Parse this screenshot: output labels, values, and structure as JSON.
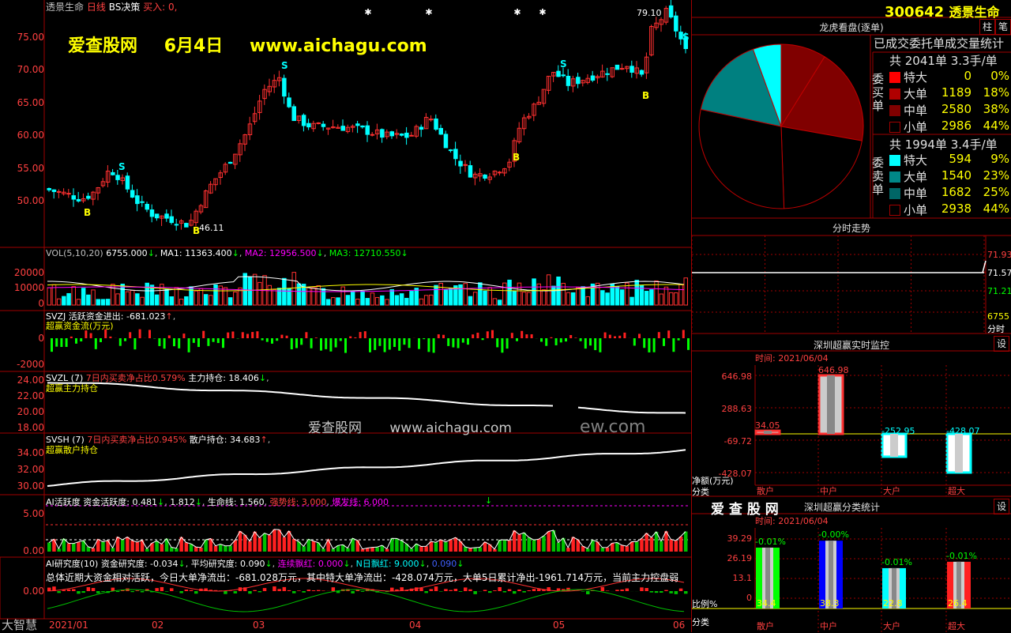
{
  "stock": {
    "code": "300642",
    "name": "透景生命"
  },
  "main": {
    "title": "透景生命",
    "period": "日线",
    "indicator": "BS决策",
    "buy_text": "买入: 0,",
    "y_ticks": [
      "75.00",
      "70.00",
      "65.00",
      "60.00",
      "55.00",
      "50.00"
    ],
    "high_label": "79.10",
    "low_label": "46.11",
    "buy_marker": "B",
    "sell_marker": "S",
    "watermark": {
      "site": "爱查股网",
      "date": "6月4日",
      "url": "www.aichagu.com"
    }
  },
  "vol": {
    "header": [
      "VOL(5,10,20)",
      "6755.000",
      "MA1: 11363.400",
      "MA2: 12956.500",
      "MA3: 12710.550"
    ],
    "y_ticks": [
      "20000",
      "10000",
      "0"
    ]
  },
  "svzj": {
    "header": [
      "SVZJ",
      "活跃资金进出: -681.023",
      "超赢资金流(万元)"
    ],
    "y_ticks": [
      "0",
      "-2000"
    ]
  },
  "svzl": {
    "header": [
      "SVZL (7)",
      "7日内买卖净占比0.579%",
      "主力持仓: 18.406",
      "超赢主力持仓"
    ],
    "y_ticks": [
      "24.00",
      "22.00",
      "20.00",
      "18.00"
    ]
  },
  "svsh": {
    "header": [
      "SVSH (7)",
      "7日内买卖净占比0.945%",
      "散户持仓: 34.683",
      "超赢散户持仓"
    ],
    "y_ticks": [
      "34.00",
      "32.00",
      "30.00"
    ]
  },
  "mid_watermark": {
    "site": "爱查股网",
    "url": "www.aichagu.com",
    "ghost": "ew.com"
  },
  "ai_active": {
    "header": [
      "AI活跃度",
      "资金活跃度: 0.481",
      "1.812",
      "生命线: 1.560",
      "强势线: 3.000",
      "爆发线: 6.000"
    ],
    "y_ticks": [
      "5.00",
      "0.00"
    ]
  },
  "ai_research": {
    "header": [
      "AI研究度(10)",
      "资金研究度: -0.034",
      "平均研究度: 0.090",
      "连续飘红: 0.000",
      "N日飘红: 9.000",
      "0.090"
    ],
    "summary": "总体近期大资金相对活跃，今日大单净流出：-681.028万元，其中特大单净流出：-428.074万元，大单5日累计净出-1961.714万元，当前主力控盘弱",
    "y_ticks": [
      "0.00"
    ]
  },
  "brand": "大智慧",
  "x_axis": [
    "2021/01",
    "02",
    "03",
    "04",
    "05",
    "06"
  ],
  "right_tabs": [
    "柱",
    "笔"
  ],
  "lhb": {
    "title": "龙虎看盘(逐单)",
    "subtitle": "已成交委托单成交量统计",
    "buy_label": "委买单",
    "sell_label": "委卖单",
    "buy_total": "共 2041单 3.3手/单",
    "sell_total": "共 1994单 3.4手/单",
    "buy_rows": [
      {
        "name": "特大",
        "count": "0",
        "pct": "0%",
        "color": "#ff0000"
      },
      {
        "name": "大单",
        "count": "1189",
        "pct": "18%",
        "color": "#b00000"
      },
      {
        "name": "中单",
        "count": "2580",
        "pct": "38%",
        "color": "#800000"
      },
      {
        "name": "小单",
        "count": "2986",
        "pct": "44%",
        "color": "#000000"
      }
    ],
    "sell_rows": [
      {
        "name": "特大",
        "count": "594",
        "pct": "9%",
        "color": "#00ffff"
      },
      {
        "name": "大单",
        "count": "1540",
        "pct": "23%",
        "color": "#008888"
      },
      {
        "name": "中单",
        "count": "1682",
        "pct": "25%",
        "color": "#006666"
      },
      {
        "name": "小单",
        "count": "2938",
        "pct": "44%",
        "color": "#000000"
      }
    ]
  },
  "intraday": {
    "title": "分时走势",
    "prices": [
      "71.93",
      "71.57",
      "71.21"
    ],
    "vol": "6755",
    "vol_label": "分时"
  },
  "monitor": {
    "title": "深圳超赢实时监控",
    "settings": "设",
    "time_label": "时间: 2021/06/04",
    "y_ticks": [
      "646.98",
      "288.63",
      "-69.72",
      "-428.07"
    ],
    "unit": "净额(万元)",
    "class_label": "分类",
    "bars": [
      {
        "name": "散户",
        "value": "34.05"
      },
      {
        "name": "中户",
        "value": "646.98"
      },
      {
        "name": "大户",
        "value": "-252.95"
      },
      {
        "name": "超大",
        "value": "-428.07"
      }
    ]
  },
  "classify": {
    "brand": "爱 查 股 网",
    "title": "深圳超赢分类统计",
    "settings": "设",
    "time_label": "时间: 2021/06/04",
    "y_ticks": [
      "39.29",
      "26.19",
      "13.1",
      "0"
    ],
    "ratio_label": "比例%",
    "class_label": "分类",
    "bars": [
      {
        "name": "散户",
        "value": "34.4",
        "delta": "-0.01%"
      },
      {
        "name": "中户",
        "value": "38.3",
        "delta": "-0.00%"
      },
      {
        "name": "大户",
        "value": "22.8",
        "delta": "-0.01%"
      },
      {
        "name": "超大",
        "value": "26.4",
        "delta": "-0.01%"
      }
    ]
  }
}
